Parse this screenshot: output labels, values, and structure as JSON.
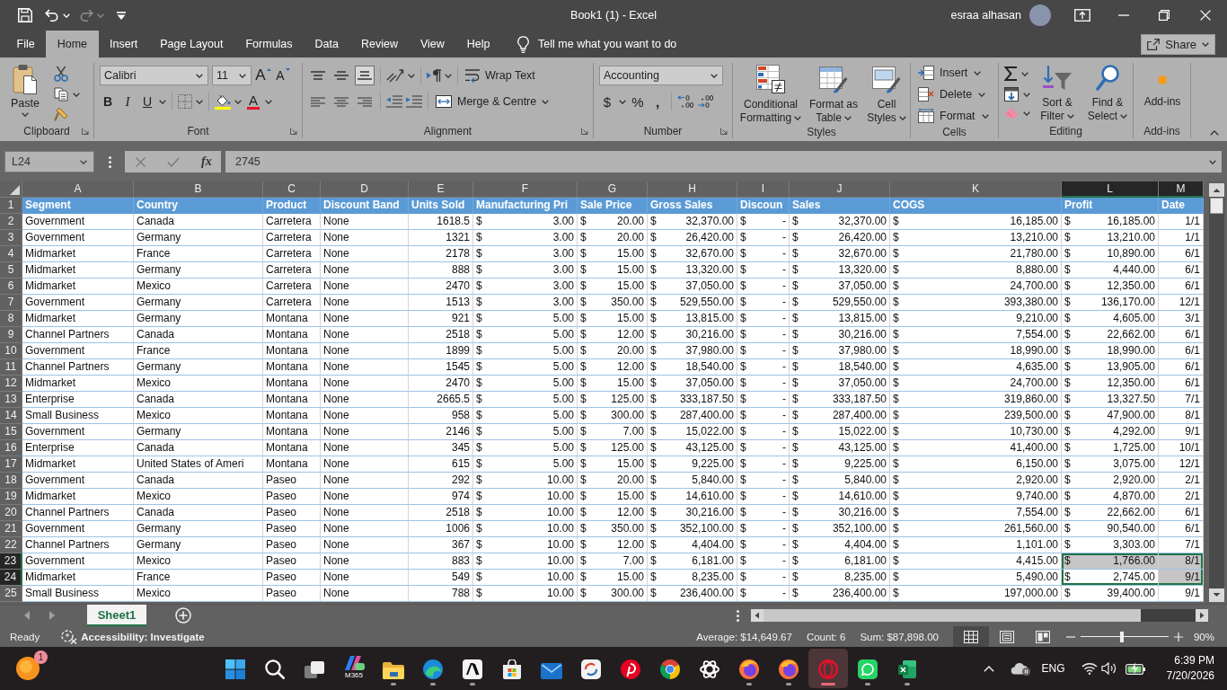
{
  "title_bar": {
    "title": "Book1 (1) - Excel",
    "user": "esraa alhasan"
  },
  "quick_access": {
    "undo_disabled": false,
    "redo_disabled": true
  },
  "ribbon_tabs": [
    {
      "label": "File",
      "selected": false
    },
    {
      "label": "Home",
      "selected": true
    },
    {
      "label": "Insert",
      "selected": false
    },
    {
      "label": "Page Layout",
      "selected": false
    },
    {
      "label": "Formulas",
      "selected": false
    },
    {
      "label": "Data",
      "selected": false
    },
    {
      "label": "Review",
      "selected": false
    },
    {
      "label": "View",
      "selected": false
    },
    {
      "label": "Help",
      "selected": false
    }
  ],
  "tell_me": "Tell me what you want to do",
  "share": "Share",
  "ribbon": {
    "groups": [
      {
        "kind": "clipboard",
        "label": "Clipboard",
        "paste": "Paste"
      },
      {
        "kind": "font",
        "label": "Font",
        "font": "Calibri",
        "size": "11",
        "grow": "A",
        "shrink": "A",
        "bold": "B",
        "italic": "I",
        "underline": "U",
        "font_color": "A"
      },
      {
        "kind": "alignment",
        "label": "Alignment",
        "align_buttons": [
          {
            "selected": false
          },
          {
            "selected": false
          },
          {
            "selected": true
          },
          {
            "selected": false
          },
          {
            "selected": false
          },
          {
            "selected": false
          }
        ],
        "wrap": "Wrap Text",
        "merge": "Merge & Centre"
      },
      {
        "kind": "number",
        "label": "Number",
        "format": "Accounting",
        "currency": "$",
        "percent": "%",
        "comma": ","
      },
      {
        "kind": "styles",
        "label": "Styles",
        "buttons": [
          "Conditional Formatting",
          "Format as Table",
          "Cell Styles"
        ]
      },
      {
        "kind": "cells",
        "label": "Cells",
        "buttons": [
          "Insert",
          "Delete",
          "Format"
        ]
      },
      {
        "kind": "editing",
        "label": "Editing",
        "buttons": [
          "Sort & Filter",
          "Find & Select"
        ]
      },
      {
        "kind": "addins",
        "label": "Add-ins",
        "buttons": [
          "Add-ins"
        ]
      }
    ]
  },
  "formula_bar": {
    "name_box": "L24",
    "function_label": "fx",
    "value": "2745"
  },
  "sheet": {
    "columns": [
      {
        "letter": "A",
        "kind": "text",
        "selected": false,
        "active": false
      },
      {
        "letter": "B",
        "kind": "text",
        "selected": false,
        "active": false
      },
      {
        "letter": "C",
        "kind": "text",
        "selected": false,
        "active": false
      },
      {
        "letter": "D",
        "kind": "text",
        "selected": false,
        "active": false
      },
      {
        "letter": "E",
        "kind": "number",
        "selected": false,
        "active": false
      },
      {
        "letter": "F",
        "kind": "accounting",
        "selected": false,
        "active": false
      },
      {
        "letter": "G",
        "kind": "accounting",
        "selected": false,
        "active": false
      },
      {
        "letter": "H",
        "kind": "accounting",
        "selected": false,
        "active": false
      },
      {
        "letter": "I",
        "kind": "accounting",
        "selected": false,
        "active": false
      },
      {
        "letter": "J",
        "kind": "accounting",
        "selected": false,
        "active": false
      },
      {
        "letter": "K",
        "kind": "accounting",
        "selected": false,
        "active": false
      },
      {
        "letter": "L",
        "kind": "accounting",
        "selected": true,
        "active": true
      },
      {
        "letter": "M",
        "kind": "date",
        "selected": true,
        "active": false
      }
    ],
    "rows": [
      {
        "number": "1",
        "kind": "header",
        "selected": false,
        "active": false,
        "cells": [
          "Segment",
          "Country",
          "Product",
          "Discount Band",
          "Units Sold",
          "Manufacturing Pri",
          "Sale Price",
          "Gross Sales",
          "Discoun",
          "Sales",
          "COGS",
          "Profit",
          "Date"
        ]
      },
      {
        "number": "2",
        "kind": "data",
        "selected": false,
        "active": false,
        "cells": [
          "Government",
          "Canada",
          "Carretera",
          "None",
          "1618.5",
          [
            "$",
            "3.00"
          ],
          [
            "$",
            "20.00"
          ],
          [
            "$",
            "32,370.00"
          ],
          [
            "$",
            "-"
          ],
          [
            "$",
            "32,370.00"
          ],
          [
            "$",
            "16,185.00"
          ],
          [
            "$",
            "16,185.00"
          ],
          "1/1"
        ]
      },
      {
        "number": "3",
        "kind": "data",
        "selected": false,
        "active": false,
        "cells": [
          "Government",
          "Germany",
          "Carretera",
          "None",
          "1321",
          [
            "$",
            "3.00"
          ],
          [
            "$",
            "20.00"
          ],
          [
            "$",
            "26,420.00"
          ],
          [
            "$",
            "-"
          ],
          [
            "$",
            "26,420.00"
          ],
          [
            "$",
            "13,210.00"
          ],
          [
            "$",
            "13,210.00"
          ],
          "1/1"
        ]
      },
      {
        "number": "4",
        "kind": "data",
        "selected": false,
        "active": false,
        "cells": [
          "Midmarket",
          "France",
          "Carretera",
          "None",
          "2178",
          [
            "$",
            "3.00"
          ],
          [
            "$",
            "15.00"
          ],
          [
            "$",
            "32,670.00"
          ],
          [
            "$",
            "-"
          ],
          [
            "$",
            "32,670.00"
          ],
          [
            "$",
            "21,780.00"
          ],
          [
            "$",
            "10,890.00"
          ],
          "6/1"
        ]
      },
      {
        "number": "5",
        "kind": "data",
        "selected": false,
        "active": false,
        "cells": [
          "Midmarket",
          "Germany",
          "Carretera",
          "None",
          "888",
          [
            "$",
            "3.00"
          ],
          [
            "$",
            "15.00"
          ],
          [
            "$",
            "13,320.00"
          ],
          [
            "$",
            "-"
          ],
          [
            "$",
            "13,320.00"
          ],
          [
            "$",
            "8,880.00"
          ],
          [
            "$",
            "4,440.00"
          ],
          "6/1"
        ]
      },
      {
        "number": "6",
        "kind": "data",
        "selected": false,
        "active": false,
        "cells": [
          "Midmarket",
          "Mexico",
          "Carretera",
          "None",
          "2470",
          [
            "$",
            "3.00"
          ],
          [
            "$",
            "15.00"
          ],
          [
            "$",
            "37,050.00"
          ],
          [
            "$",
            "-"
          ],
          [
            "$",
            "37,050.00"
          ],
          [
            "$",
            "24,700.00"
          ],
          [
            "$",
            "12,350.00"
          ],
          "6/1"
        ]
      },
      {
        "number": "7",
        "kind": "data",
        "selected": false,
        "active": false,
        "cells": [
          "Government",
          "Germany",
          "Carretera",
          "None",
          "1513",
          [
            "$",
            "3.00"
          ],
          [
            "$",
            "350.00"
          ],
          [
            "$",
            "529,550.00"
          ],
          [
            "$",
            "-"
          ],
          [
            "$",
            "529,550.00"
          ],
          [
            "$",
            "393,380.00"
          ],
          [
            "$",
            "136,170.00"
          ],
          "12/1"
        ]
      },
      {
        "number": "8",
        "kind": "data",
        "selected": false,
        "active": false,
        "cells": [
          "Midmarket",
          "Germany",
          "Montana",
          "None",
          "921",
          [
            "$",
            "5.00"
          ],
          [
            "$",
            "15.00"
          ],
          [
            "$",
            "13,815.00"
          ],
          [
            "$",
            "-"
          ],
          [
            "$",
            "13,815.00"
          ],
          [
            "$",
            "9,210.00"
          ],
          [
            "$",
            "4,605.00"
          ],
          "3/1"
        ]
      },
      {
        "number": "9",
        "kind": "data",
        "selected": false,
        "active": false,
        "cells": [
          "Channel Partners",
          "Canada",
          "Montana",
          "None",
          "2518",
          [
            "$",
            "5.00"
          ],
          [
            "$",
            "12.00"
          ],
          [
            "$",
            "30,216.00"
          ],
          [
            "$",
            "-"
          ],
          [
            "$",
            "30,216.00"
          ],
          [
            "$",
            "7,554.00"
          ],
          [
            "$",
            "22,662.00"
          ],
          "6/1"
        ]
      },
      {
        "number": "10",
        "kind": "data",
        "selected": false,
        "active": false,
        "cells": [
          "Government",
          "France",
          "Montana",
          "None",
          "1899",
          [
            "$",
            "5.00"
          ],
          [
            "$",
            "20.00"
          ],
          [
            "$",
            "37,980.00"
          ],
          [
            "$",
            "-"
          ],
          [
            "$",
            "37,980.00"
          ],
          [
            "$",
            "18,990.00"
          ],
          [
            "$",
            "18,990.00"
          ],
          "6/1"
        ]
      },
      {
        "number": "11",
        "kind": "data",
        "selected": false,
        "active": false,
        "cells": [
          "Channel Partners",
          "Germany",
          "Montana",
          "None",
          "1545",
          [
            "$",
            "5.00"
          ],
          [
            "$",
            "12.00"
          ],
          [
            "$",
            "18,540.00"
          ],
          [
            "$",
            "-"
          ],
          [
            "$",
            "18,540.00"
          ],
          [
            "$",
            "4,635.00"
          ],
          [
            "$",
            "13,905.00"
          ],
          "6/1"
        ]
      },
      {
        "number": "12",
        "kind": "data",
        "selected": false,
        "active": false,
        "cells": [
          "Midmarket",
          "Mexico",
          "Montana",
          "None",
          "2470",
          [
            "$",
            "5.00"
          ],
          [
            "$",
            "15.00"
          ],
          [
            "$",
            "37,050.00"
          ],
          [
            "$",
            "-"
          ],
          [
            "$",
            "37,050.00"
          ],
          [
            "$",
            "24,700.00"
          ],
          [
            "$",
            "12,350.00"
          ],
          "6/1"
        ]
      },
      {
        "number": "13",
        "kind": "data",
        "selected": false,
        "active": false,
        "cells": [
          "Enterprise",
          "Canada",
          "Montana",
          "None",
          "2665.5",
          [
            "$",
            "5.00"
          ],
          [
            "$",
            "125.00"
          ],
          [
            "$",
            "333,187.50"
          ],
          [
            "$",
            "-"
          ],
          [
            "$",
            "333,187.50"
          ],
          [
            "$",
            "319,860.00"
          ],
          [
            "$",
            "13,327.50"
          ],
          "7/1"
        ]
      },
      {
        "number": "14",
        "kind": "data",
        "selected": false,
        "active": false,
        "cells": [
          "Small Business",
          "Mexico",
          "Montana",
          "None",
          "958",
          [
            "$",
            "5.00"
          ],
          [
            "$",
            "300.00"
          ],
          [
            "$",
            "287,400.00"
          ],
          [
            "$",
            "-"
          ],
          [
            "$",
            "287,400.00"
          ],
          [
            "$",
            "239,500.00"
          ],
          [
            "$",
            "47,900.00"
          ],
          "8/1"
        ]
      },
      {
        "number": "15",
        "kind": "data",
        "selected": false,
        "active": false,
        "cells": [
          "Government",
          "Germany",
          "Montana",
          "None",
          "2146",
          [
            "$",
            "5.00"
          ],
          [
            "$",
            "7.00"
          ],
          [
            "$",
            "15,022.00"
          ],
          [
            "$",
            "-"
          ],
          [
            "$",
            "15,022.00"
          ],
          [
            "$",
            "10,730.00"
          ],
          [
            "$",
            "4,292.00"
          ],
          "9/1"
        ]
      },
      {
        "number": "16",
        "kind": "data",
        "selected": false,
        "active": false,
        "cells": [
          "Enterprise",
          "Canada",
          "Montana",
          "None",
          "345",
          [
            "$",
            "5.00"
          ],
          [
            "$",
            "125.00"
          ],
          [
            "$",
            "43,125.00"
          ],
          [
            "$",
            "-"
          ],
          [
            "$",
            "43,125.00"
          ],
          [
            "$",
            "41,400.00"
          ],
          [
            "$",
            "1,725.00"
          ],
          "10/1"
        ]
      },
      {
        "number": "17",
        "kind": "data",
        "selected": false,
        "active": false,
        "cells": [
          "Midmarket",
          "United States of Ameri",
          "Montana",
          "None",
          "615",
          [
            "$",
            "5.00"
          ],
          [
            "$",
            "15.00"
          ],
          [
            "$",
            "9,225.00"
          ],
          [
            "$",
            "-"
          ],
          [
            "$",
            "9,225.00"
          ],
          [
            "$",
            "6,150.00"
          ],
          [
            "$",
            "3,075.00"
          ],
          "12/1"
        ]
      },
      {
        "number": "18",
        "kind": "data",
        "selected": false,
        "active": false,
        "cells": [
          "Government",
          "Canada",
          "Paseo",
          "None",
          "292",
          [
            "$",
            "10.00"
          ],
          [
            "$",
            "20.00"
          ],
          [
            "$",
            "5,840.00"
          ],
          [
            "$",
            "-"
          ],
          [
            "$",
            "5,840.00"
          ],
          [
            "$",
            "2,920.00"
          ],
          [
            "$",
            "2,920.00"
          ],
          "2/1"
        ]
      },
      {
        "number": "19",
        "kind": "data",
        "selected": false,
        "active": false,
        "cells": [
          "Midmarket",
          "Mexico",
          "Paseo",
          "None",
          "974",
          [
            "$",
            "10.00"
          ],
          [
            "$",
            "15.00"
          ],
          [
            "$",
            "14,610.00"
          ],
          [
            "$",
            "-"
          ],
          [
            "$",
            "14,610.00"
          ],
          [
            "$",
            "9,740.00"
          ],
          [
            "$",
            "4,870.00"
          ],
          "2/1"
        ]
      },
      {
        "number": "20",
        "kind": "data",
        "selected": false,
        "active": false,
        "cells": [
          "Channel Partners",
          "Canada",
          "Paseo",
          "None",
          "2518",
          [
            "$",
            "10.00"
          ],
          [
            "$",
            "12.00"
          ],
          [
            "$",
            "30,216.00"
          ],
          [
            "$",
            "-"
          ],
          [
            "$",
            "30,216.00"
          ],
          [
            "$",
            "7,554.00"
          ],
          [
            "$",
            "22,662.00"
          ],
          "6/1"
        ]
      },
      {
        "number": "21",
        "kind": "data",
        "selected": false,
        "active": false,
        "cells": [
          "Government",
          "Germany",
          "Paseo",
          "None",
          "1006",
          [
            "$",
            "10.00"
          ],
          [
            "$",
            "350.00"
          ],
          [
            "$",
            "352,100.00"
          ],
          [
            "$",
            "-"
          ],
          [
            "$",
            "352,100.00"
          ],
          [
            "$",
            "261,560.00"
          ],
          [
            "$",
            "90,540.00"
          ],
          "6/1"
        ]
      },
      {
        "number": "22",
        "kind": "data",
        "selected": false,
        "active": false,
        "cells": [
          "Channel Partners",
          "Germany",
          "Paseo",
          "None",
          "367",
          [
            "$",
            "10.00"
          ],
          [
            "$",
            "12.00"
          ],
          [
            "$",
            "4,404.00"
          ],
          [
            "$",
            "-"
          ],
          [
            "$",
            "4,404.00"
          ],
          [
            "$",
            "1,101.00"
          ],
          [
            "$",
            "3,303.00"
          ],
          "7/1"
        ]
      },
      {
        "number": "23",
        "kind": "data",
        "selected": true,
        "active": false,
        "cells": [
          "Government",
          "Mexico",
          "Paseo",
          "None",
          "883",
          [
            "$",
            "10.00"
          ],
          [
            "$",
            "7.00"
          ],
          [
            "$",
            "6,181.00"
          ],
          [
            "$",
            "-"
          ],
          [
            "$",
            "6,181.00"
          ],
          [
            "$",
            "4,415.00"
          ],
          [
            "$",
            "1,766.00"
          ],
          "8/1"
        ]
      },
      {
        "number": "24",
        "kind": "data",
        "selected": true,
        "active": true,
        "cells": [
          "Midmarket",
          "France",
          "Paseo",
          "None",
          "549",
          [
            "$",
            "10.00"
          ],
          [
            "$",
            "15.00"
          ],
          [
            "$",
            "8,235.00"
          ],
          [
            "$",
            "-"
          ],
          [
            "$",
            "8,235.00"
          ],
          [
            "$",
            "5,490.00"
          ],
          [
            "$",
            "2,745.00"
          ],
          "9/1"
        ]
      },
      {
        "number": "25",
        "kind": "data",
        "selected": false,
        "active": false,
        "cells": [
          "Small Business",
          "Mexico",
          "Paseo",
          "None",
          "788",
          [
            "$",
            "10.00"
          ],
          [
            "$",
            "300.00"
          ],
          [
            "$",
            "236,400.00"
          ],
          [
            "$",
            "-"
          ],
          [
            "$",
            "236,400.00"
          ],
          [
            "$",
            "197,000.00"
          ],
          [
            "$",
            "39,400.00"
          ],
          "9/1"
        ]
      }
    ]
  },
  "sheet_tabs": [
    {
      "label": "Sheet1",
      "selected": true
    }
  ],
  "status_bar": {
    "mode": "Ready",
    "accessibility": "Accessibility: Investigate",
    "average": "Average: $14,649.67",
    "count": "Count: 6",
    "sum": "Sum: $87,898.00",
    "views": [
      {
        "selected": true
      },
      {
        "selected": false
      },
      {
        "selected": false
      }
    ],
    "zoom": {
      "level": 0.47,
      "reading": "90%"
    }
  },
  "taskbar": {
    "widget_badge": "1",
    "apps": [
      {
        "kind": "start",
        "running": false,
        "selected": false
      },
      {
        "kind": "search",
        "running": false,
        "selected": false
      },
      {
        "kind": "taskview",
        "running": false,
        "selected": false
      },
      {
        "kind": "suite",
        "label": "M365",
        "running": false,
        "selected": false
      },
      {
        "kind": "folder",
        "running": true,
        "selected": false
      },
      {
        "kind": "wave",
        "running": true,
        "selected": false
      },
      {
        "kind": "tile",
        "running": true,
        "selected": false
      },
      {
        "kind": "bag",
        "running": false,
        "selected": false
      },
      {
        "kind": "mail",
        "running": false,
        "selected": false
      },
      {
        "kind": "sync",
        "running": false,
        "selected": false
      },
      {
        "kind": "pin",
        "running": false,
        "selected": false
      },
      {
        "kind": "wheel",
        "running": false,
        "selected": false
      },
      {
        "kind": "knot",
        "running": false,
        "selected": false
      },
      {
        "kind": "fox",
        "running": true,
        "selected": false
      },
      {
        "kind": "fox",
        "running": true,
        "selected": false
      },
      {
        "kind": "ring",
        "running": true,
        "selected": true
      },
      {
        "kind": "chat",
        "running": true,
        "selected": false
      },
      {
        "kind": "sheet",
        "running": true,
        "selected": false
      }
    ],
    "tray": {
      "language": "ENG",
      "time": "6:39 PM",
      "date": "7/20/2026"
    }
  }
}
